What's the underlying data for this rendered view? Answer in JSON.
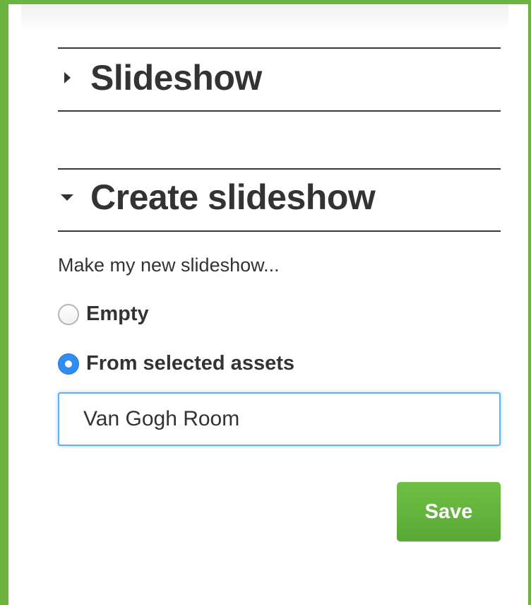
{
  "colors": {
    "frame_border": "#6db33f",
    "save_button": "#63b33c",
    "radio_selected": "#2f8cf0",
    "input_focus_border": "#66aef2",
    "text": "#333333"
  },
  "sections": [
    {
      "title": "Slideshow",
      "expanded": false,
      "icon": "caret-right-icon"
    },
    {
      "title": "Create slideshow",
      "expanded": true,
      "icon": "caret-down-icon"
    }
  ],
  "create_slideshow": {
    "prompt": "Make my new slideshow...",
    "options": [
      {
        "label": "Empty",
        "selected": false
      },
      {
        "label": "From selected assets",
        "selected": true
      }
    ],
    "name_input": {
      "value": "Van Gogh Room",
      "placeholder": ""
    },
    "save_label": "Save"
  }
}
